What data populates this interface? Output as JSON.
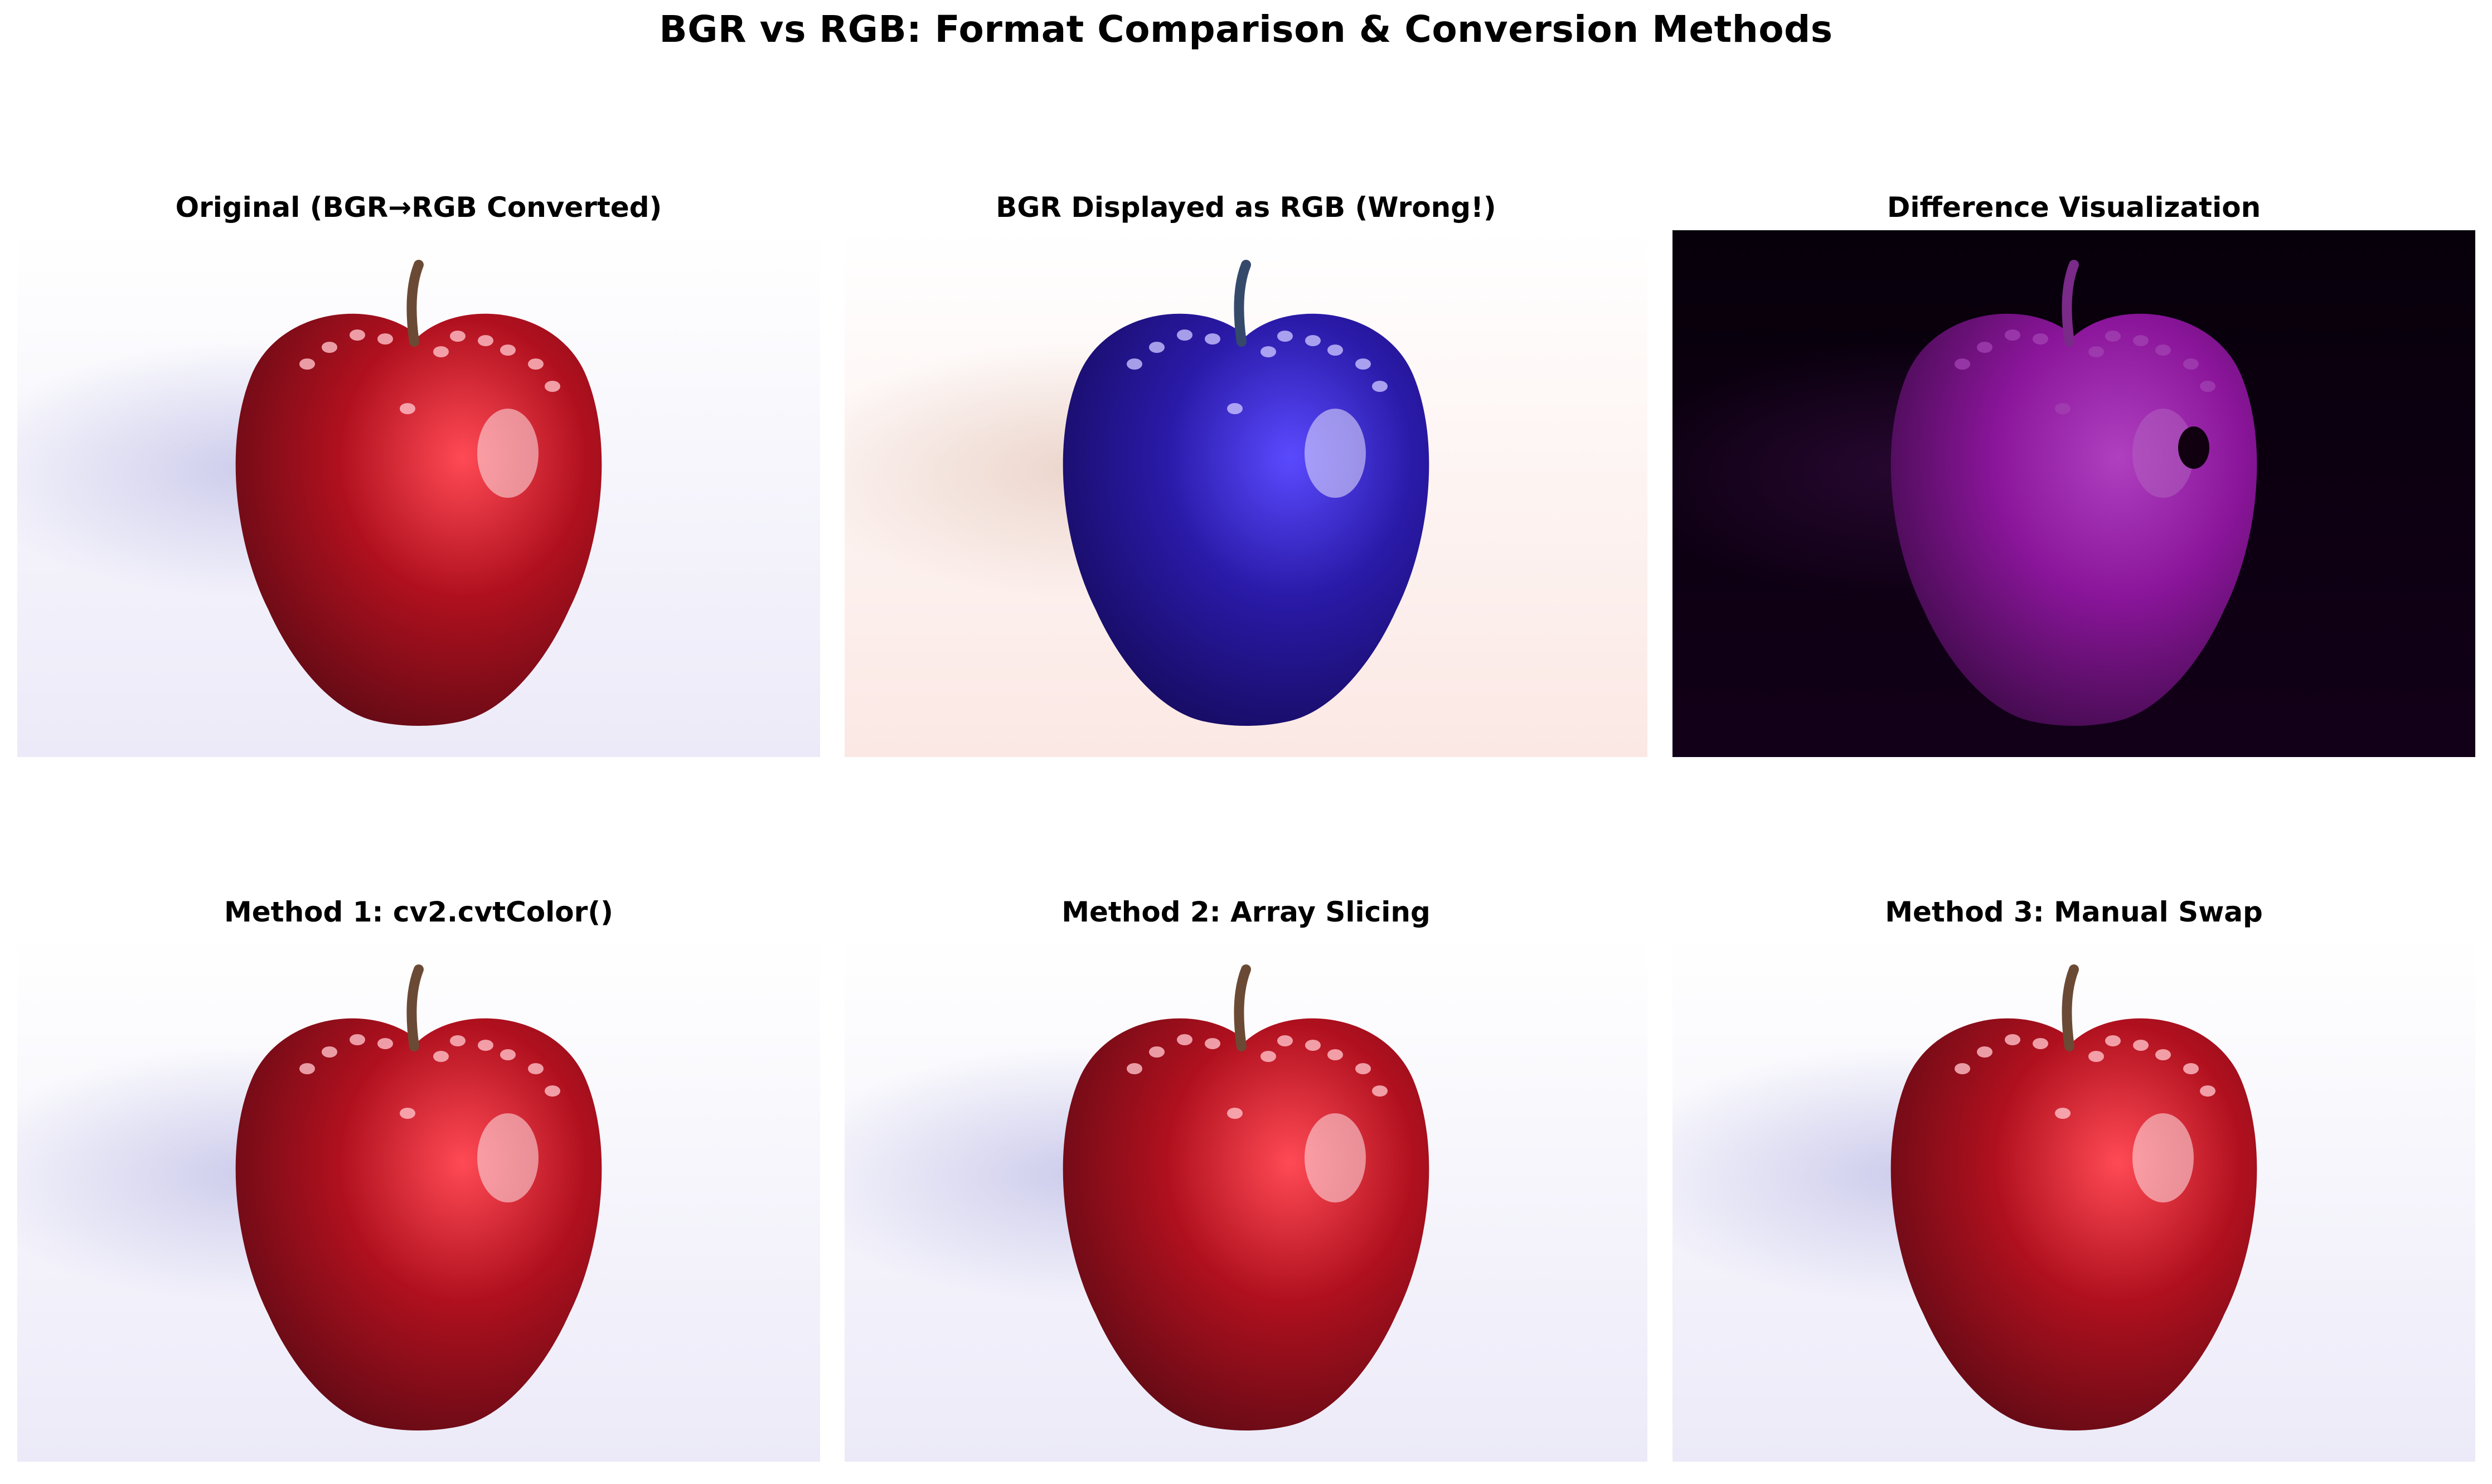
{
  "figure": {
    "title": "BGR vs RGB: Format Comparison & Conversion Methods"
  },
  "panels": [
    {
      "title": "Original (BGR→RGB Converted)",
      "variant": "rgb"
    },
    {
      "title": "BGR Displayed as RGB (Wrong!)",
      "variant": "bgr"
    },
    {
      "title": "Difference Visualization",
      "variant": "diff"
    },
    {
      "title": "Method 1: cv2.cvtColor()",
      "variant": "rgb"
    },
    {
      "title": "Method 2: Array Slicing",
      "variant": "rgb"
    },
    {
      "title": "Method 3: Manual Swap",
      "variant": "rgb"
    }
  ],
  "colors": {
    "apple_red": "#b0101e",
    "apple_blue": "#2a1aa8",
    "diff_magenta": "#8a159a",
    "diff_background": "#07000a"
  }
}
